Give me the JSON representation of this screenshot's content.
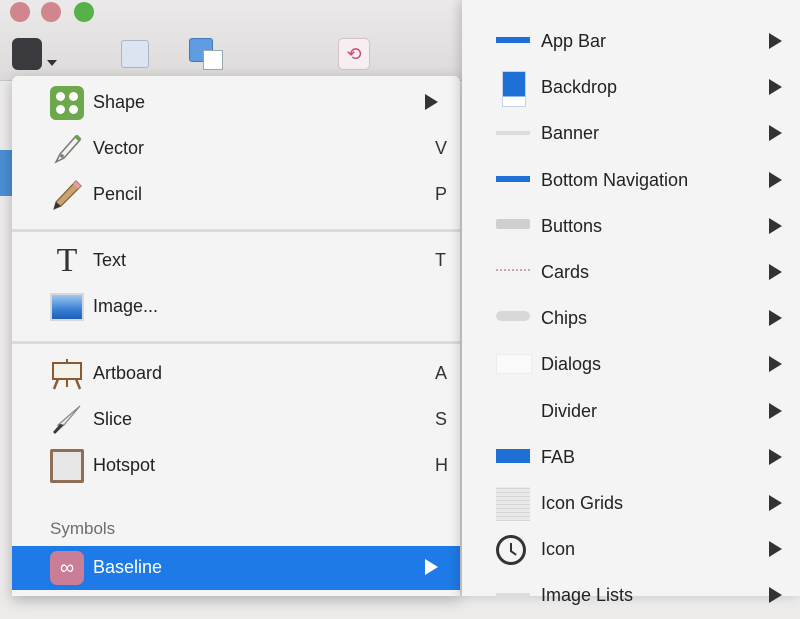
{
  "menu": {
    "items": [
      {
        "label": "Shape",
        "icon": "shape-icon",
        "submenu": true
      },
      {
        "label": "Vector",
        "icon": "pen-tool-icon",
        "shortcut": "V"
      },
      {
        "label": "Pencil",
        "icon": "pencil-icon",
        "shortcut": "P"
      },
      {
        "label": "Text",
        "icon": "text-icon",
        "shortcut": "T"
      },
      {
        "label": "Image...",
        "icon": "image-icon"
      },
      {
        "label": "Artboard",
        "icon": "artboard-icon",
        "shortcut": "A"
      },
      {
        "label": "Slice",
        "icon": "slice-knife-icon",
        "shortcut": "S"
      },
      {
        "label": "Hotspot",
        "icon": "hotspot-icon",
        "shortcut": "H"
      }
    ],
    "section_header": "Symbols",
    "selected": {
      "label": "Baseline",
      "icon": "baseline-icon",
      "submenu": true
    }
  },
  "submenu": {
    "items": [
      {
        "label": "App Bar",
        "icon": "app-bar-icon"
      },
      {
        "label": "Backdrop",
        "icon": "backdrop-icon"
      },
      {
        "label": "Banner",
        "icon": "banner-icon"
      },
      {
        "label": "Bottom Navigation",
        "icon": "bottom-navigation-icon"
      },
      {
        "label": "Buttons",
        "icon": "buttons-icon"
      },
      {
        "label": "Cards",
        "icon": "cards-icon"
      },
      {
        "label": "Chips",
        "icon": "chips-icon"
      },
      {
        "label": "Dialogs",
        "icon": "dialogs-icon"
      },
      {
        "label": "Divider",
        "icon": "divider-icon"
      },
      {
        "label": "FAB",
        "icon": "fab-icon"
      },
      {
        "label": "Icon Grids",
        "icon": "icon-grids-icon"
      },
      {
        "label": "Icon",
        "icon": "clock-icon"
      },
      {
        "label": "Image Lists",
        "icon": "image-lists-icon"
      }
    ]
  },
  "colors": {
    "selected_bg": "#1e7ae6",
    "menu_bg": "#f5f4f4",
    "accent_blue": "#1e6fd6"
  }
}
